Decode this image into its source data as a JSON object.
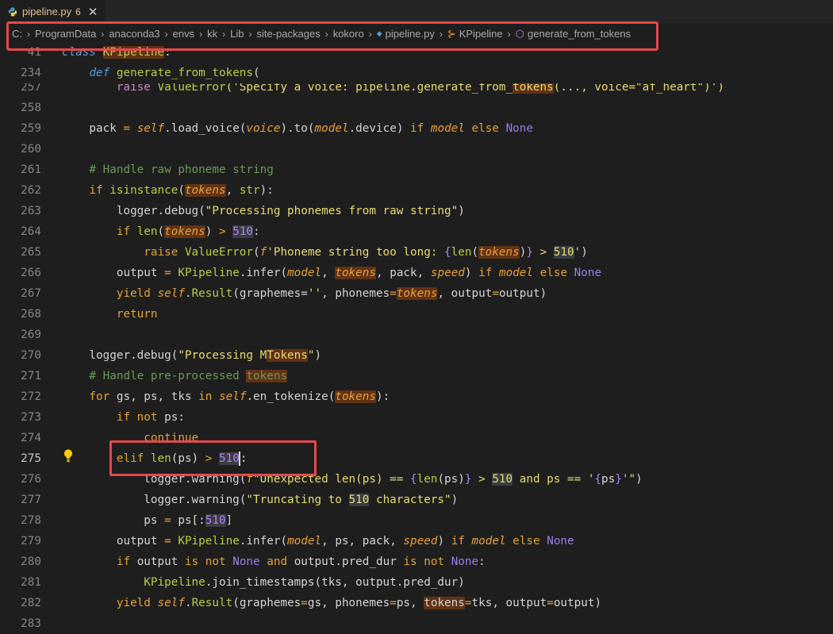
{
  "tab": {
    "filename": "pipeline.py",
    "problems": "6",
    "close": "✕"
  },
  "breadcrumb": [
    "C:",
    "ProgramData",
    "anaconda3",
    "envs",
    "kk",
    "Lib",
    "site-packages",
    "kokoro",
    "pipeline.py",
    "KPipeline",
    "generate_from_tokens"
  ],
  "sticky": [
    {
      "ln": "41",
      "parts": [
        [
          "class ",
          "kw it"
        ],
        [
          "KPipeline",
          "c-green hl"
        ],
        [
          ":",
          ""
        ]
      ]
    },
    {
      "ln": "234",
      "parts": [
        [
          "    "
        ],
        [
          "def ",
          "kw it"
        ],
        [
          "generate_from_tokens",
          "c-green"
        ],
        [
          "(",
          ""
        ]
      ]
    }
  ],
  "lines": [
    {
      "ln": "257",
      "parts": [
        [
          "        raise ",
          "kwc"
        ],
        [
          "ValueError",
          "c-green"
        ],
        [
          "('Specify a voice: pipeline.generate_from_",
          "c-str"
        ],
        [
          "tokens",
          "c-str hl"
        ],
        [
          "(..., voice=\"af_heart\")')",
          "c-str"
        ]
      ]
    },
    {
      "ln": "258",
      "parts": []
    },
    {
      "ln": "259",
      "parts": [
        [
          "    pack "
        ],
        [
          "= ",
          "c-orange"
        ],
        [
          "self",
          "c-orange it"
        ],
        [
          ".load_voice("
        ],
        [
          "voice",
          "c-orange it"
        ],
        [
          ").to("
        ],
        [
          "model",
          "c-orange it"
        ],
        [
          ".device) "
        ],
        [
          "if ",
          "k-if"
        ],
        [
          "model",
          "c-orange it"
        ],
        [
          " else ",
          "k-if"
        ],
        [
          "None",
          "k-none"
        ]
      ]
    },
    {
      "ln": "260",
      "parts": []
    },
    {
      "ln": "261",
      "parts": [
        [
          "    # Handle raw phoneme string",
          "cm"
        ]
      ]
    },
    {
      "ln": "262",
      "parts": [
        [
          "    if ",
          "k-if"
        ],
        [
          "isinstance",
          "c-green"
        ],
        [
          "("
        ],
        [
          "tokens",
          "c-orange it hl"
        ],
        [
          ", "
        ],
        [
          "str",
          "c-green"
        ],
        [
          "):"
        ]
      ]
    },
    {
      "ln": "263",
      "parts": [
        [
          "        logger.debug("
        ],
        [
          "\"Processing phonemes from raw string\"",
          "c-str"
        ],
        [
          ")"
        ]
      ]
    },
    {
      "ln": "264",
      "parts": [
        [
          "        if ",
          "k-if"
        ],
        [
          "len",
          "c-green"
        ],
        [
          "("
        ],
        [
          "tokens",
          "c-orange it hl"
        ],
        [
          ") "
        ],
        [
          "> ",
          "c-orange"
        ],
        [
          "510",
          "c-num hl2"
        ],
        [
          ":"
        ]
      ]
    },
    {
      "ln": "265",
      "parts": [
        [
          "            raise ",
          "k-if"
        ],
        [
          "ValueError",
          "c-green"
        ],
        [
          "("
        ],
        [
          "f",
          "c-orange it"
        ],
        [
          "'Phoneme string too long: ",
          "c-str"
        ],
        [
          "{",
          "c-num"
        ],
        [
          "len",
          "c-green"
        ],
        [
          "("
        ],
        [
          "tokens",
          "c-orange it hl"
        ],
        [
          ")"
        ],
        [
          "}",
          "c-num"
        ],
        [
          " > ",
          "c-str"
        ],
        [
          "510",
          "c-str hl2"
        ],
        [
          "'",
          "c-str"
        ],
        [
          ")"
        ]
      ]
    },
    {
      "ln": "266",
      "parts": [
        [
          "        output "
        ],
        [
          "= ",
          "c-orange"
        ],
        [
          "KPipeline",
          "c-green"
        ],
        [
          ".infer("
        ],
        [
          "model",
          "c-orange it"
        ],
        [
          ", "
        ],
        [
          "tokens",
          "c-orange it hl"
        ],
        [
          ", pack, "
        ],
        [
          "speed",
          "c-orange it"
        ],
        [
          ") "
        ],
        [
          "if ",
          "k-if"
        ],
        [
          "model",
          "c-orange it"
        ],
        [
          " else ",
          "k-if"
        ],
        [
          "None",
          "k-none"
        ]
      ]
    },
    {
      "ln": "267",
      "parts": [
        [
          "        yield ",
          "k-if"
        ],
        [
          "self",
          "c-orange it"
        ],
        [
          "."
        ],
        [
          "Result",
          "c-green"
        ],
        [
          "(graphemes="
        ],
        [
          "''",
          "c-str"
        ],
        [
          ", phonemes"
        ],
        [
          "=",
          "c-orange"
        ],
        [
          "tokens",
          "c-orange it hl"
        ],
        [
          ", output"
        ],
        [
          "=",
          "c-orange"
        ],
        [
          "output)"
        ]
      ]
    },
    {
      "ln": "268",
      "parts": [
        [
          "        return",
          "k-if"
        ]
      ]
    },
    {
      "ln": "269",
      "parts": []
    },
    {
      "ln": "270",
      "parts": [
        [
          "    logger.debug("
        ],
        [
          "\"Processing M",
          "c-str"
        ],
        [
          "Tokens",
          "c-str hl"
        ],
        [
          "\"",
          "c-str"
        ],
        [
          ")"
        ]
      ]
    },
    {
      "ln": "271",
      "parts": [
        [
          "    # Handle pre-processed ",
          "cm"
        ],
        [
          "tokens",
          "cm hl"
        ]
      ]
    },
    {
      "ln": "272",
      "parts": [
        [
          "    for ",
          "k-if"
        ],
        [
          "gs, ps, tks "
        ],
        [
          "in ",
          "k-if"
        ],
        [
          "self",
          "c-orange it"
        ],
        [
          ".en_tokenize("
        ],
        [
          "tokens",
          "c-orange it hl"
        ],
        [
          "):"
        ]
      ]
    },
    {
      "ln": "273",
      "parts": [
        [
          "        if not ",
          "k-if"
        ],
        [
          "ps:"
        ]
      ]
    },
    {
      "ln": "274",
      "parts": [
        [
          "            continue",
          "k-if"
        ]
      ]
    },
    {
      "ln": "275",
      "parts": [
        [
          "        elif ",
          "k-if"
        ],
        [
          "len",
          "c-green"
        ],
        [
          "(ps) "
        ],
        [
          "> ",
          "c-orange"
        ],
        [
          "510",
          "c-num hl2"
        ],
        [
          ":"
        ]
      ]
    },
    {
      "ln": "276",
      "parts": [
        [
          "            logger.warning("
        ],
        [
          "f",
          "c-orange it"
        ],
        [
          "\"Unexpected len(ps) == ",
          "c-str"
        ],
        [
          "{",
          "c-num"
        ],
        [
          "len",
          "c-green"
        ],
        [
          "(ps)"
        ],
        [
          "}",
          "c-num"
        ],
        [
          " > ",
          "c-str"
        ],
        [
          "510",
          "c-str hl2"
        ],
        [
          " and ps == '",
          "c-str"
        ],
        [
          "{",
          "c-num"
        ],
        [
          "ps"
        ],
        [
          "}",
          "c-num"
        ],
        [
          "'\"",
          "c-str"
        ],
        [
          ")"
        ]
      ]
    },
    {
      "ln": "277",
      "parts": [
        [
          "            logger.warning("
        ],
        [
          "\"Truncating to ",
          "c-str"
        ],
        [
          "510",
          "c-str hl2"
        ],
        [
          " characters\"",
          "c-str"
        ],
        [
          ")"
        ]
      ]
    },
    {
      "ln": "278",
      "parts": [
        [
          "            ps "
        ],
        [
          "= ",
          "c-orange"
        ],
        [
          "ps[:"
        ],
        [
          "510",
          "c-num hl2"
        ],
        [
          "]"
        ]
      ]
    },
    {
      "ln": "279",
      "parts": [
        [
          "        output "
        ],
        [
          "= ",
          "c-orange"
        ],
        [
          "KPipeline",
          "c-green"
        ],
        [
          ".infer("
        ],
        [
          "model",
          "c-orange it"
        ],
        [
          ", ps, pack, "
        ],
        [
          "speed",
          "c-orange it"
        ],
        [
          ") "
        ],
        [
          "if ",
          "k-if"
        ],
        [
          "model",
          "c-orange it"
        ],
        [
          " else ",
          "k-if"
        ],
        [
          "None",
          "k-none"
        ]
      ]
    },
    {
      "ln": "280",
      "parts": [
        [
          "        if ",
          "k-if"
        ],
        [
          "output "
        ],
        [
          "is not ",
          "k-if"
        ],
        [
          "None ",
          "k-none"
        ],
        [
          "and ",
          "k-if"
        ],
        [
          "output.pred_dur "
        ],
        [
          "is not ",
          "k-if"
        ],
        [
          "None",
          "k-none"
        ],
        [
          ":"
        ]
      ]
    },
    {
      "ln": "281",
      "parts": [
        [
          "            "
        ],
        [
          "KPipeline",
          "c-green"
        ],
        [
          ".join_timestamps(tks, output.pred_dur)"
        ]
      ]
    },
    {
      "ln": "282",
      "parts": [
        [
          "        yield ",
          "k-if"
        ],
        [
          "self",
          "c-orange it"
        ],
        [
          "."
        ],
        [
          "Result",
          "c-green"
        ],
        [
          "(graphemes"
        ],
        [
          "=",
          "c-orange"
        ],
        [
          "gs, phonemes"
        ],
        [
          "=",
          "c-orange"
        ],
        [
          "ps, "
        ],
        [
          "tokens",
          "hl"
        ],
        [
          "=",
          "c-orange"
        ],
        [
          "tks, output"
        ],
        [
          "=",
          "c-orange"
        ],
        [
          "output)"
        ]
      ]
    },
    {
      "ln": "283",
      "parts": []
    }
  ],
  "active_line": "275"
}
